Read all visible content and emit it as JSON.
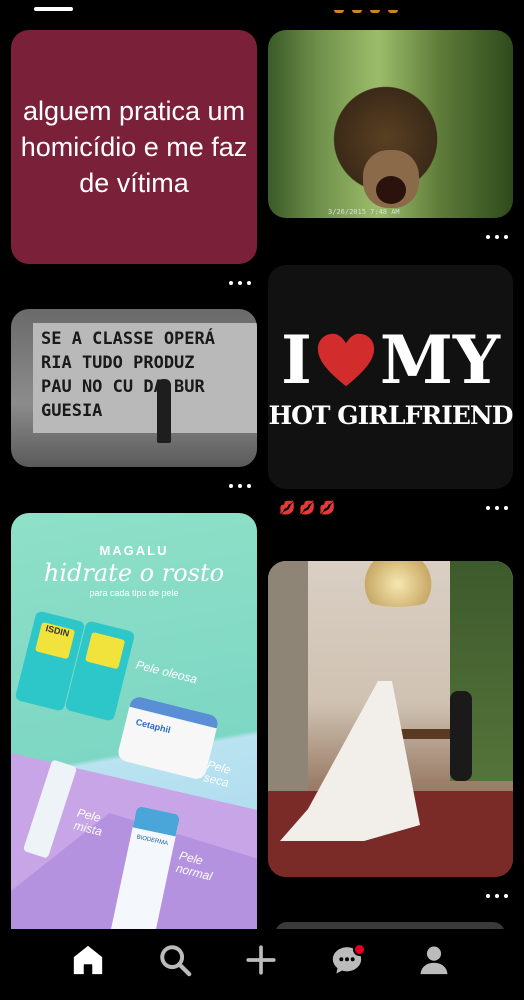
{
  "feed": {
    "pins": [
      {
        "id": "text-pin",
        "text": "alguem pratica um homicídio e me faz de vítima",
        "bg": "#7b2039"
      },
      {
        "id": "bear-pin",
        "stamp": "3/26/2015  7:48 AM"
      },
      {
        "id": "graffiti-pin",
        "graffiti": "SE A CLASSE OPERÁ\nRIA TUDO PRODUZ\nPAU NO CU DA BUR\nGUESIA"
      },
      {
        "id": "shirt-pin",
        "line1_left": "I",
        "line1_right": "MY",
        "line2": "HOT GIRLFRIEND",
        "caption": "💋💋💋"
      },
      {
        "id": "magalu-pin",
        "brand": "MAGALU",
        "headline": "hidrate o rosto",
        "sub": "para cada tipo de pele",
        "labels": [
          "Pele oleosa",
          "Pele seca",
          "Pele mista",
          "Pele normal"
        ],
        "products": [
          "ISDIN",
          "Cetaphil",
          "BIODERMA"
        ]
      },
      {
        "id": "wedding-pin"
      }
    ]
  },
  "nav": {
    "items": [
      "home",
      "search",
      "create",
      "messages",
      "profile"
    ],
    "active": "home",
    "notification_color": "#e60023"
  }
}
